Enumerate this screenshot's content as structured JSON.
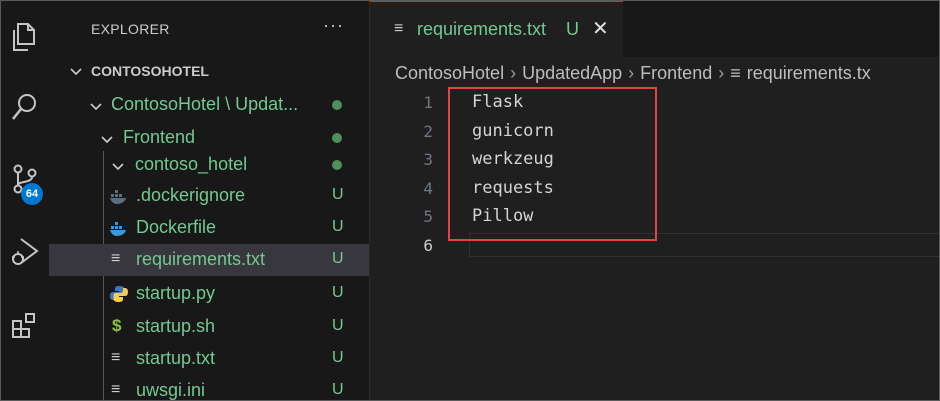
{
  "activity_bar": {
    "items": [
      {
        "name": "explorer-icon"
      },
      {
        "name": "search-icon"
      },
      {
        "name": "source-control-icon"
      },
      {
        "name": "run-debug-icon"
      },
      {
        "name": "extensions-icon"
      }
    ],
    "badge": "64"
  },
  "sidebar": {
    "title": "EXPLORER",
    "more": "···",
    "tree": [
      {
        "label": "CONTOSOHOTEL",
        "kind": "root"
      },
      {
        "label": "ContosoHotel \\ Updat...",
        "kind": "folder",
        "status": "dot"
      },
      {
        "label": "Frontend",
        "kind": "folder",
        "status": "dot"
      },
      {
        "label": "contoso_hotel",
        "kind": "folder",
        "status": "dot"
      },
      {
        "label": ".dockerignore",
        "kind": "file",
        "icon": "docker-icon",
        "status": "U"
      },
      {
        "label": "Dockerfile",
        "kind": "file",
        "icon": "docker-icon",
        "status": "U"
      },
      {
        "label": "requirements.txt",
        "kind": "file",
        "icon": "text-file-icon",
        "status": "U",
        "selected": true
      },
      {
        "label": "startup.py",
        "kind": "file",
        "icon": "python-icon",
        "status": "U"
      },
      {
        "label": "startup.sh",
        "kind": "file",
        "icon": "shell-icon",
        "status": "U"
      },
      {
        "label": "startup.txt",
        "kind": "file",
        "icon": "text-file-icon",
        "status": "U"
      },
      {
        "label": "uwsgi.ini",
        "kind": "file",
        "icon": "text-file-icon",
        "status": "U"
      }
    ]
  },
  "editor": {
    "tab": {
      "label": "requirements.txt",
      "status": "U",
      "close": "✕"
    },
    "breadcrumbs": [
      "ContosoHotel",
      "UpdatedApp",
      "Frontend",
      "requirements.tx"
    ],
    "lines": [
      {
        "n": "1",
        "text": "Flask"
      },
      {
        "n": "2",
        "text": "gunicorn"
      },
      {
        "n": "3",
        "text": "werkzeug"
      },
      {
        "n": "4",
        "text": "requests"
      },
      {
        "n": "5",
        "text": "Pillow"
      },
      {
        "n": "6",
        "text": ""
      }
    ]
  },
  "colors": {
    "accent": "#0078d4",
    "untracked": "#73c991",
    "highlight": "#e0463f"
  }
}
